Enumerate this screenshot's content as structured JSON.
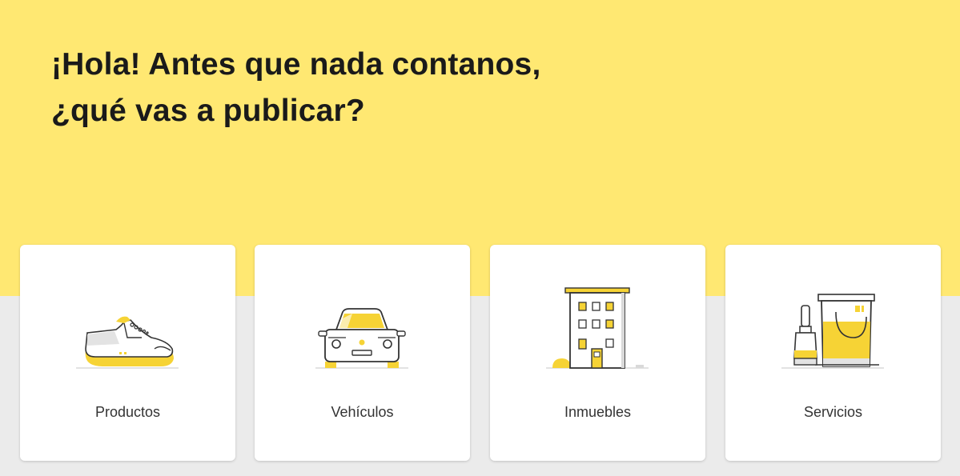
{
  "hero": {
    "title_line1": "¡Hola! Antes que nada contanos,",
    "title_line2": "¿qué vas a publicar?"
  },
  "categories": [
    {
      "label": "Productos",
      "icon": "sneaker-icon"
    },
    {
      "label": "Vehículos",
      "icon": "car-icon"
    },
    {
      "label": "Inmuebles",
      "icon": "building-icon"
    },
    {
      "label": "Servicios",
      "icon": "paint-bucket-icon"
    }
  ],
  "colors": {
    "hero_bg": "#ffe872",
    "page_bg": "#ebebeb",
    "accent": "#f6d335",
    "card_bg": "#ffffff",
    "text": "#333333"
  }
}
